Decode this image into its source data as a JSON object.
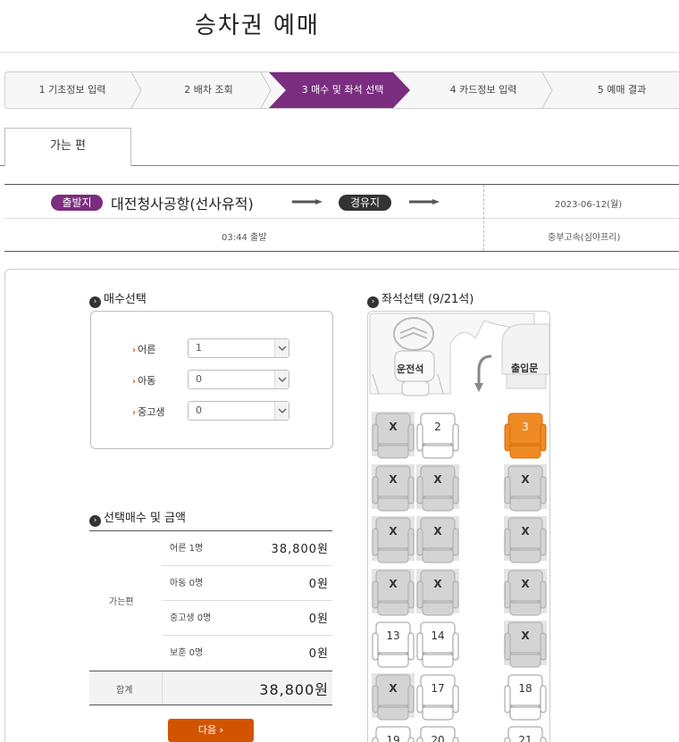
{
  "page_title": "승차권 예매",
  "steps": [
    {
      "label": "1 기초정보 입력"
    },
    {
      "label": "2 배차 조회"
    },
    {
      "label": "3 매수 및 좌석 선택"
    },
    {
      "label": "4 카드정보 입력"
    },
    {
      "label": "5 예매 결과"
    }
  ],
  "tab": {
    "label": "가는 편"
  },
  "route": {
    "depart_badge": "출발지",
    "depart_name": "대전청사공항(선사유적)",
    "via_badge": "경유지",
    "date": "2023-06-12(월)",
    "time": "03:44 출발",
    "company": "중부고속(심야프리)"
  },
  "quantity": {
    "title": "매수선택",
    "rows": [
      {
        "label": "어른",
        "value": "1"
      },
      {
        "label": "아동",
        "value": "0"
      },
      {
        "label": "중고생",
        "value": "0"
      }
    ]
  },
  "seat_select": {
    "title": "좌석선택 (9/21석)",
    "driver": "운전석",
    "entrance": "출입문"
  },
  "price": {
    "title": "선택매수 및 금액",
    "group_label": "가는편",
    "rows": [
      {
        "label": "어른 1명",
        "value": "38,800원"
      },
      {
        "label": "아동 0명",
        "value": "0원"
      },
      {
        "label": "중고생 0명",
        "value": "0원"
      },
      {
        "label": "보훈 0명",
        "value": "0원"
      }
    ],
    "total_label": "합계",
    "total_value": "38,800원"
  },
  "next_button": "다음",
  "seats": [
    {
      "label": "X",
      "state": "taken"
    },
    {
      "label": "2",
      "state": "free"
    },
    {
      "label": "3",
      "state": "selected"
    },
    {
      "label": "X",
      "state": "taken"
    },
    {
      "label": "X",
      "state": "taken"
    },
    {
      "label": "X",
      "state": "taken"
    },
    {
      "label": "X",
      "state": "taken"
    },
    {
      "label": "X",
      "state": "taken"
    },
    {
      "label": "X",
      "state": "taken"
    },
    {
      "label": "X",
      "state": "taken"
    },
    {
      "label": "X",
      "state": "taken"
    },
    {
      "label": "X",
      "state": "taken"
    },
    {
      "label": "13",
      "state": "free"
    },
    {
      "label": "14",
      "state": "free"
    },
    {
      "label": "X",
      "state": "taken"
    },
    {
      "label": "X",
      "state": "taken"
    },
    {
      "label": "17",
      "state": "free"
    },
    {
      "label": "18",
      "state": "free"
    },
    {
      "label": "19",
      "state": "free"
    },
    {
      "label": "20",
      "state": "free"
    },
    {
      "label": "21",
      "state": "free"
    }
  ],
  "colors": {
    "accent": "#7b2d80",
    "selected_seat": "#f08a24",
    "button": "#d35400"
  }
}
